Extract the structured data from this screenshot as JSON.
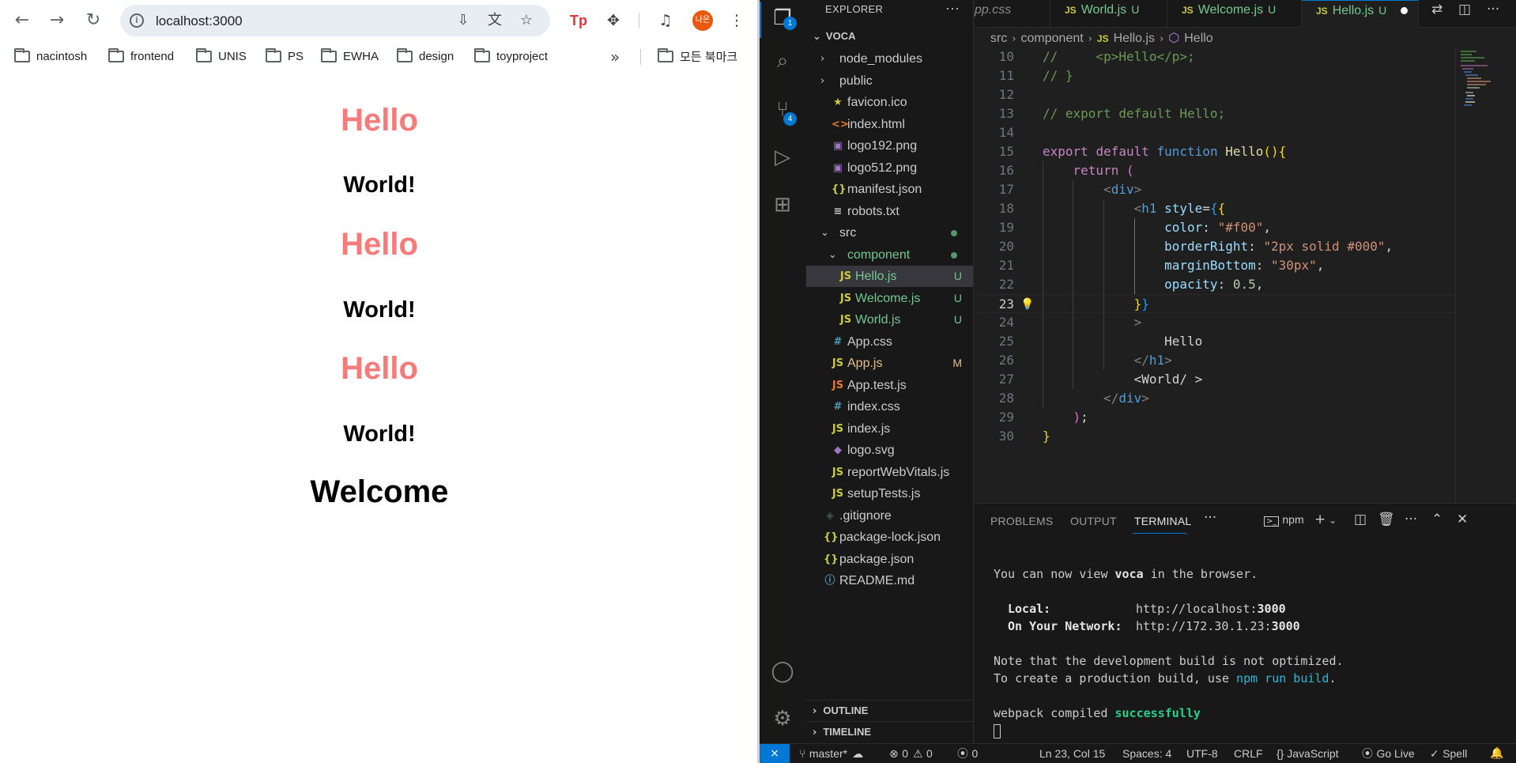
{
  "browser": {
    "url": "localhost:3000",
    "profile_initials": "나은",
    "bookmarks": [
      "nacintosh",
      "frontend",
      "UNIS",
      "PS",
      "EWHA",
      "design",
      "toyproject"
    ],
    "all_bookmarks_label": "모든 북마크",
    "page": {
      "blocks": [
        {
          "type": "hello",
          "text": "Hello"
        },
        {
          "type": "world",
          "text": "World!"
        },
        {
          "type": "hello",
          "text": "Hello"
        },
        {
          "type": "world",
          "text": "World!"
        },
        {
          "type": "hello",
          "text": "Hello"
        },
        {
          "type": "world",
          "text": "World!"
        },
        {
          "type": "welcome",
          "text": "Welcome"
        }
      ]
    }
  },
  "vscode": {
    "explorer_title": "EXPLORER",
    "workspace": "VOCA",
    "tree": [
      {
        "label": "node_modules",
        "kind": "folder",
        "open": false,
        "depth": 0,
        "icon_color": "",
        "status": ""
      },
      {
        "label": "public",
        "kind": "folder",
        "open": false,
        "depth": 0,
        "icon_color": "",
        "status": ""
      },
      {
        "label": "favicon.ico",
        "kind": "file",
        "icon": "★",
        "icon_color": "#cbcb41",
        "depth": 1,
        "status": ""
      },
      {
        "label": "index.html",
        "kind": "file",
        "icon": "<>",
        "icon_color": "#e37933",
        "depth": 1,
        "status": ""
      },
      {
        "label": "logo192.png",
        "kind": "file",
        "icon": "▣",
        "icon_color": "#a074c4",
        "depth": 1,
        "status": ""
      },
      {
        "label": "logo512.png",
        "kind": "file",
        "icon": "▣",
        "icon_color": "#a074c4",
        "depth": 1,
        "status": ""
      },
      {
        "label": "manifest.json",
        "kind": "file",
        "icon": "{}",
        "icon_color": "#cbcb41",
        "depth": 1,
        "status": ""
      },
      {
        "label": "robots.txt",
        "kind": "file",
        "icon": "≡",
        "icon_color": "#cccccc",
        "depth": 1,
        "status": ""
      },
      {
        "label": "src",
        "kind": "folder",
        "open": true,
        "depth": 0,
        "status_dot": "#73c991"
      },
      {
        "label": "component",
        "kind": "folder",
        "open": true,
        "depth": 1,
        "status_dot": "#73c991",
        "label_color": "#73c991"
      },
      {
        "label": "Hello.js",
        "kind": "file",
        "icon": "JS",
        "icon_color": "#cbcb41",
        "depth": 2,
        "status": "U",
        "label_color": "#73c991",
        "selected": true
      },
      {
        "label": "Welcome.js",
        "kind": "file",
        "icon": "JS",
        "icon_color": "#cbcb41",
        "depth": 2,
        "status": "U",
        "label_color": "#73c991"
      },
      {
        "label": "World.js",
        "kind": "file",
        "icon": "JS",
        "icon_color": "#cbcb41",
        "depth": 2,
        "status": "U",
        "label_color": "#73c991"
      },
      {
        "label": "App.css",
        "kind": "file",
        "icon": "#",
        "icon_color": "#519aba",
        "depth": 1,
        "status": ""
      },
      {
        "label": "App.js",
        "kind": "file",
        "icon": "JS",
        "icon_color": "#cbcb41",
        "depth": 1,
        "status": "M",
        "label_color": "#e2c08d"
      },
      {
        "label": "App.test.js",
        "kind": "file",
        "icon": "JS",
        "icon_color": "#e37933",
        "depth": 1,
        "status": ""
      },
      {
        "label": "index.css",
        "kind": "file",
        "icon": "#",
        "icon_color": "#519aba",
        "depth": 1,
        "status": ""
      },
      {
        "label": "index.js",
        "kind": "file",
        "icon": "JS",
        "icon_color": "#cbcb41",
        "depth": 1,
        "status": ""
      },
      {
        "label": "logo.svg",
        "kind": "file",
        "icon": "◆",
        "icon_color": "#a074c4",
        "depth": 1,
        "status": ""
      },
      {
        "label": "reportWebVitals.js",
        "kind": "file",
        "icon": "JS",
        "icon_color": "#cbcb41",
        "depth": 1,
        "status": ""
      },
      {
        "label": "setupTests.js",
        "kind": "file",
        "icon": "JS",
        "icon_color": "#cbcb41",
        "depth": 1,
        "status": ""
      },
      {
        "label": ".gitignore",
        "kind": "file",
        "icon": "◈",
        "icon_color": "#41535b",
        "depth": 0,
        "status": ""
      },
      {
        "label": "package-lock.json",
        "kind": "file",
        "icon": "{}",
        "icon_color": "#cbcb41",
        "depth": 0,
        "status": ""
      },
      {
        "label": "package.json",
        "kind": "file",
        "icon": "{}",
        "icon_color": "#cbcb41",
        "depth": 0,
        "status": ""
      },
      {
        "label": "README.md",
        "kind": "file",
        "icon": "ⓘ",
        "icon_color": "#519aba",
        "depth": 0,
        "status": ""
      }
    ],
    "outline_label": "OUTLINE",
    "timeline_label": "TIMELINE",
    "tabs": [
      {
        "label": "pp.css",
        "status": "",
        "active": false
      },
      {
        "label": "World.js",
        "status": "U",
        "active": false
      },
      {
        "label": "Welcome.js",
        "status": "U",
        "active": false
      },
      {
        "label": "Hello.js",
        "status": "U",
        "active": true
      }
    ],
    "breadcrumb": [
      "src",
      "component",
      "Hello.js",
      "Hello"
    ],
    "current_line": 23,
    "badges": {
      "explorer": "1",
      "scm": "4"
    },
    "terminal": {
      "tabs": [
        "PROBLEMS",
        "OUTPUT",
        "TERMINAL"
      ],
      "active_tab": "TERMINAL",
      "shell_label": "npm",
      "line1_pre": "You can now view ",
      "line1_app": "voca",
      "line1_post": " in the browser.",
      "local_label": "Local:",
      "local_url_pre": "http://localhost:",
      "local_url_port": "3000",
      "network_label": "On Your Network:",
      "network_url_pre": "http://172.30.1.23:",
      "network_url_port": "3000",
      "note1": "Note that the development build is not optimized.",
      "note2_pre": "To create a production build, use ",
      "note2_cmd": "npm run build",
      "note2_post": ".",
      "compiled_pre": "webpack compiled ",
      "compiled_status": "successfully"
    },
    "status": {
      "branch": "master*",
      "errors": "0",
      "warnings": "0",
      "ports": "0",
      "position": "Ln 23, Col 15",
      "spaces": "Spaces: 4",
      "encoding": "UTF-8",
      "eol": "CRLF",
      "language": "JavaScript",
      "golive": "Go Live",
      "spell": "Spell"
    }
  }
}
